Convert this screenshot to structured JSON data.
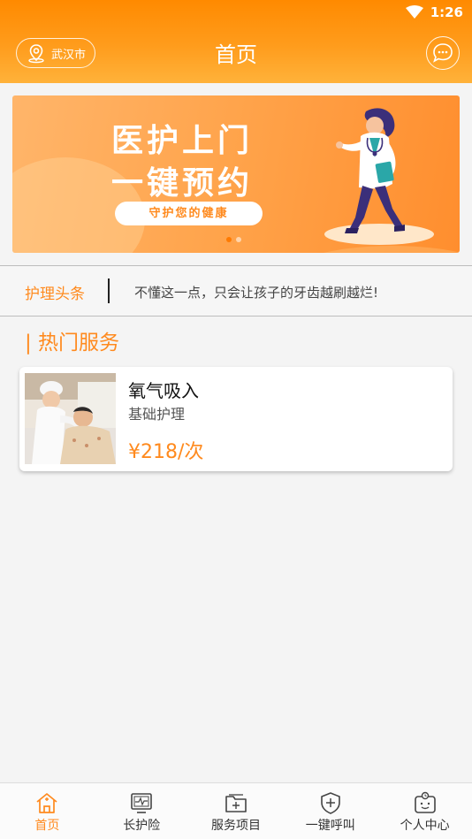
{
  "status_bar": {
    "time": "1:26"
  },
  "header": {
    "city": "武汉市",
    "title": "首页"
  },
  "banner": {
    "line1": "医护上门",
    "line2": "一键预约",
    "slogan": "守护您的健康",
    "active_slide": 1,
    "slide_count": 2
  },
  "news": {
    "tag": "护理头条",
    "headline": "不懂这一点，只会让孩子的牙齿越刷越烂!"
  },
  "section_title": "| 热门服务",
  "services": [
    {
      "name": "氧气吸入",
      "category": "基础护理",
      "price": "¥218/次"
    }
  ],
  "tabs": [
    {
      "label": "首页",
      "icon": "home-icon",
      "active": true
    },
    {
      "label": "长护险",
      "icon": "monitor-icon",
      "active": false
    },
    {
      "label": "服务项目",
      "icon": "folder-plus-icon",
      "active": false
    },
    {
      "label": "一键呼叫",
      "icon": "shield-plus-icon",
      "active": false
    },
    {
      "label": "个人中心",
      "icon": "user-face-icon",
      "active": false
    }
  ],
  "colors": {
    "accent": "#ff8a1e",
    "header_top": "#ff8a00",
    "header_bottom": "#ffb23a"
  }
}
